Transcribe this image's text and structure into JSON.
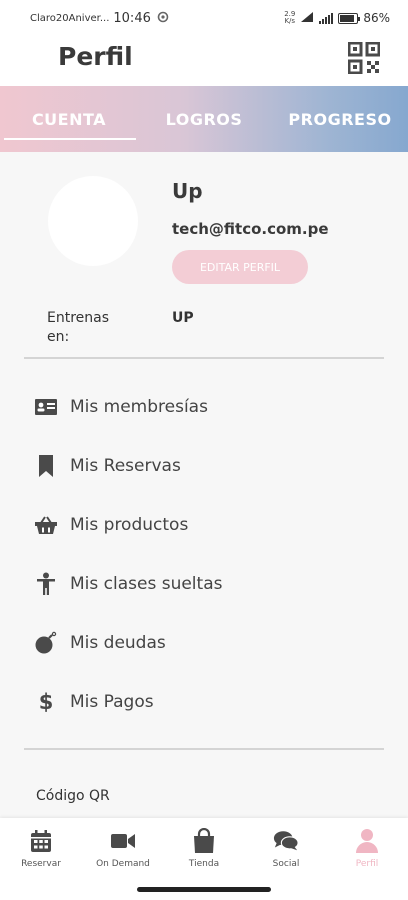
{
  "status_bar": {
    "carrier": "Claro20Aniver...",
    "time": "10:46",
    "net_speed_value": "2.9",
    "net_speed_unit": "K/s",
    "battery": "86%",
    "battery_level": 0.86
  },
  "header": {
    "title": "Perfil",
    "qr_icon": "qr-code-icon"
  },
  "tabs": [
    {
      "label": "CUENTA",
      "active": true
    },
    {
      "label": "LOGROS",
      "active": false
    },
    {
      "label": "PROGRESO",
      "active": false
    }
  ],
  "profile": {
    "name": "Up",
    "email": "tech@fitco.com.pe",
    "edit_button": "EDITAR PERFIL",
    "trains_label": "Entrenas en:",
    "trains_value": "UP"
  },
  "menu": [
    {
      "label": "Mis membresías",
      "icon": "id-card-icon"
    },
    {
      "label": "Mis Reservas",
      "icon": "bookmark-icon"
    },
    {
      "label": "Mis productos",
      "icon": "basket-icon"
    },
    {
      "label": "Mis clases sueltas",
      "icon": "person-icon"
    },
    {
      "label": "Mis deudas",
      "icon": "bomb-icon"
    },
    {
      "label": "Mis Pagos",
      "icon": "dollar-icon"
    }
  ],
  "qr_section": {
    "label": "Código QR"
  },
  "bottom_nav": [
    {
      "label": "Reservar",
      "icon": "calendar-icon",
      "active": false
    },
    {
      "label": "On Demand",
      "icon": "video-camera-icon",
      "active": false
    },
    {
      "label": "Tienda",
      "icon": "shopping-bag-icon",
      "active": false
    },
    {
      "label": "Social",
      "icon": "chat-bubbles-icon",
      "active": false
    },
    {
      "label": "Perfil",
      "icon": "user-icon",
      "active": true
    }
  ],
  "colors": {
    "accent_pink": "#f0b6c3",
    "tab_gradient_start": "#f0c7d0",
    "tab_gradient_end": "#86a8cf",
    "edit_button": "#f3cdd5",
    "icon_dark": "#4a4a4a"
  }
}
